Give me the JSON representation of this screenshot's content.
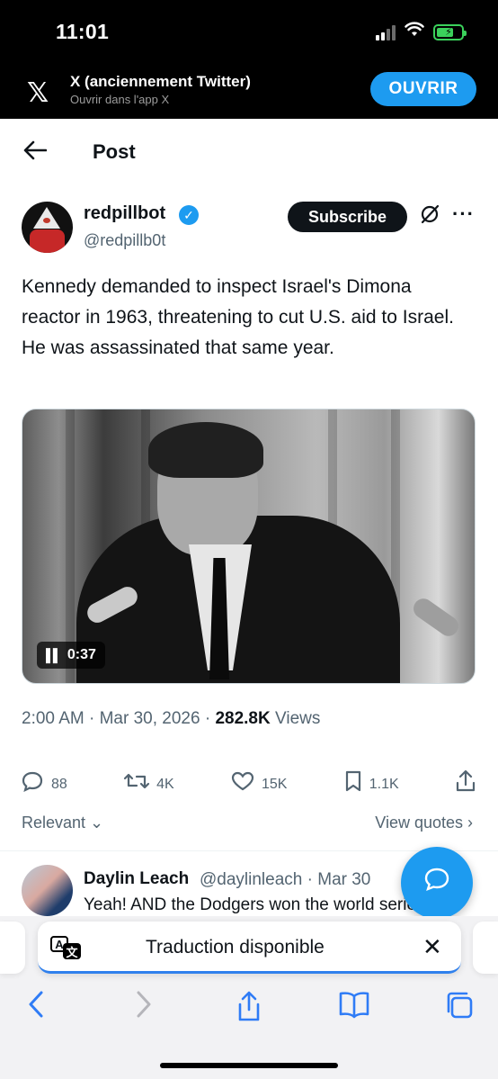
{
  "status_bar": {
    "time": "11:01"
  },
  "app_banner": {
    "title": "X (anciennement Twitter)",
    "subtitle": "Ouvrir dans l'app X",
    "open_button": "OUVRIR"
  },
  "header": {
    "title": "Post"
  },
  "post": {
    "author_name": "redpillbot",
    "author_handle": "@redpillb0t",
    "subscribe_label": "Subscribe",
    "text": "Kennedy demanded to inspect Israel's Dimona reactor in 1963, threatening to cut U.S. aid to Israel. He was assassinated that same year.",
    "video_time": "0:37",
    "timestamp": "2:00 AM · Mar 30, 2026 · ",
    "views_count": "282.8K",
    "views_label": " Views",
    "replies": "88",
    "reposts": "4K",
    "likes": "15K",
    "bookmarks": "1.1K"
  },
  "filters": {
    "sort": "Relevant",
    "view_quotes": "View quotes"
  },
  "reply": {
    "name": "Daylin Leach",
    "handle": "@daylinleach · Mar 30",
    "text": "Yeah! AND the Dodgers won the world series"
  },
  "translation": {
    "text": "Traduction disponible"
  },
  "colors": {
    "accent": "#1d9bf0",
    "safari_blue": "#2f7cf6",
    "battery": "#3bd15b"
  }
}
